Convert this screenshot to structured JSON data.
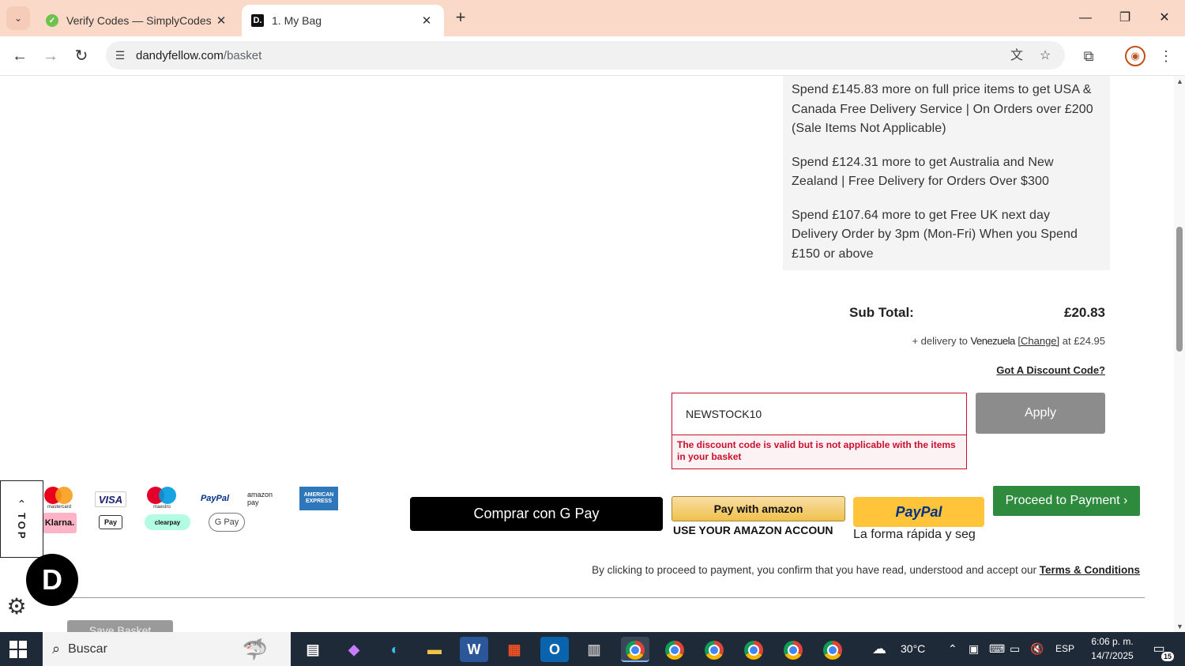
{
  "browser": {
    "tabs": [
      {
        "title": "Verify Codes — SimplyCodes",
        "favicon": "simplycodes-icon",
        "active": false
      },
      {
        "title": "1. My Bag",
        "favicon": "dandyfellow-icon",
        "active": true
      }
    ],
    "url_domain": "dandyfellow.com",
    "url_path": "/basket"
  },
  "delivery_messages": [
    "Spend £145.83 more on full price items to get USA & Canada Free Delivery Service | On Orders over £200 (Sale Items Not Applicable)",
    "Spend £124.31 more to get Australia and New Zealand | Free Delivery for Orders Over $300",
    "Spend £107.64 more to get Free UK next day Delivery Order by 3pm (Mon-Fri) When you Spend £150 or above"
  ],
  "totals": {
    "subtotal_label": "Sub Total:",
    "subtotal_value": "£20.83",
    "delivery_prefix": "+ delivery to",
    "delivery_country": "Venezuela",
    "change_label": "[Change]",
    "delivery_suffix": "at £24.95"
  },
  "discount": {
    "link_label": "Got A Discount Code?",
    "code_value": "NEWSTOCK10",
    "error": "The discount code is valid but is not applicable with the items in your basket",
    "apply_label": "Apply"
  },
  "payment_logos": {
    "mastercard": "mastercard",
    "visa": "VISA",
    "maestro": "maestro",
    "paypal": "PayPal",
    "amazonpay": "amazon pay",
    "amex": "AMERICAN EXPRESS",
    "klarna": "Klarna.",
    "applepay": "Pay",
    "clearpay": "clearpay",
    "gpay": "G Pay"
  },
  "checkout": {
    "gpay_label": "Comprar con G Pay",
    "amazon_label": "Pay with amazon",
    "amazon_sub": "USE YOUR AMAZON ACCOUN",
    "paypal_label": "PayPal",
    "paypal_sub": "La forma rápida y seg",
    "proceed_label": "Proceed to Payment ›",
    "tnc_text": "By clicking to proceed to payment, you confirm that you have read, understood and accept our",
    "tnc_link": "Terms & Conditions",
    "save_basket": "Save Basket"
  },
  "widgets": {
    "top_label": "TOP",
    "brand_letter": "D"
  },
  "taskbar": {
    "search_placeholder": "Buscar",
    "weather": "30°C",
    "language": "ESP",
    "time": "6:06 p. m.",
    "date": "14/7/2025",
    "notifications": "15"
  },
  "colors": {
    "tabstrip": "#fbd9c8",
    "error": "#c8102e",
    "proceed": "#2e8b3e",
    "apply": "#8c8c8c",
    "taskbar": "#1f2a38"
  }
}
